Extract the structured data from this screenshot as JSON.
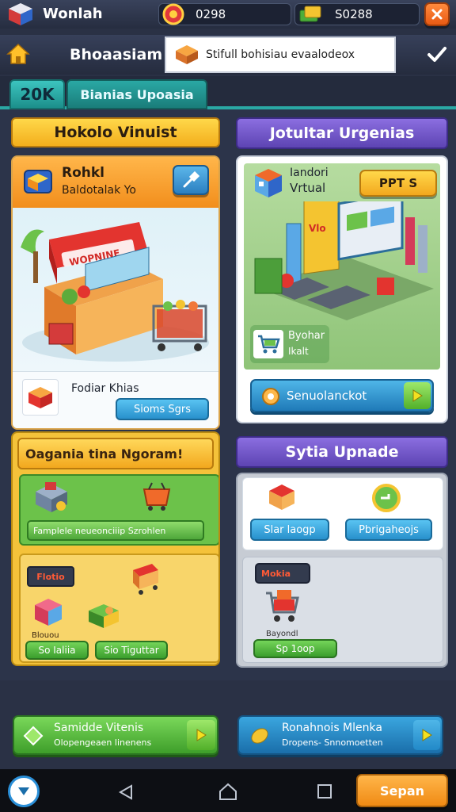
{
  "topbar": {
    "app_title": "Wonlah",
    "currency_1": "0298",
    "currency_2": "S0288"
  },
  "navbar": {
    "title": "Bhoaasiam",
    "search_value": "Stifull bohisiau evaalodeox"
  },
  "tabs": {
    "active": "20K",
    "label": "Bianias Upoasia"
  },
  "left": {
    "header": "Hokolo Vinuist",
    "shop_card": {
      "title": "Rohkl",
      "subtitle": "Baldotalak Yo",
      "sign": "WOPNINE"
    },
    "detail_label": "Fodiar Khias",
    "detail_button": "Sioms Sgrs",
    "banner": "Oagania tina Ngoram!",
    "task_button": "Famplele neueonciiip Szrohlen",
    "mini_sign": "Flotio",
    "mini_label": "Blouou",
    "btn_a": "So Ialiia",
    "btn_b": "Sio Tiguttar"
  },
  "right": {
    "header": "Jotultar Urgenias",
    "card": {
      "title": "Iandori",
      "subtitle": "Vrtual",
      "badge": "PPT S",
      "sign": "Vlo"
    },
    "cart_title": "Byohar",
    "cart_sub": "Ikalt",
    "cta": "Senuolanckot",
    "header2": "Sytia Upnade",
    "upg_btn_1": "Slar laogp",
    "upg_btn_2": "Pbrigaheojs",
    "lower_sign": "Mokia",
    "lower_label": "Bayondl",
    "lower_btn": "Sp 1oop"
  },
  "bottom": {
    "left_title": "Samidde Vitenis",
    "left_sub": "Olopengeaen linenens",
    "right_title": "Ronahnois Mlenka",
    "right_sub": "Dropens- Snnomoetten",
    "nav_button": "Sepan"
  }
}
